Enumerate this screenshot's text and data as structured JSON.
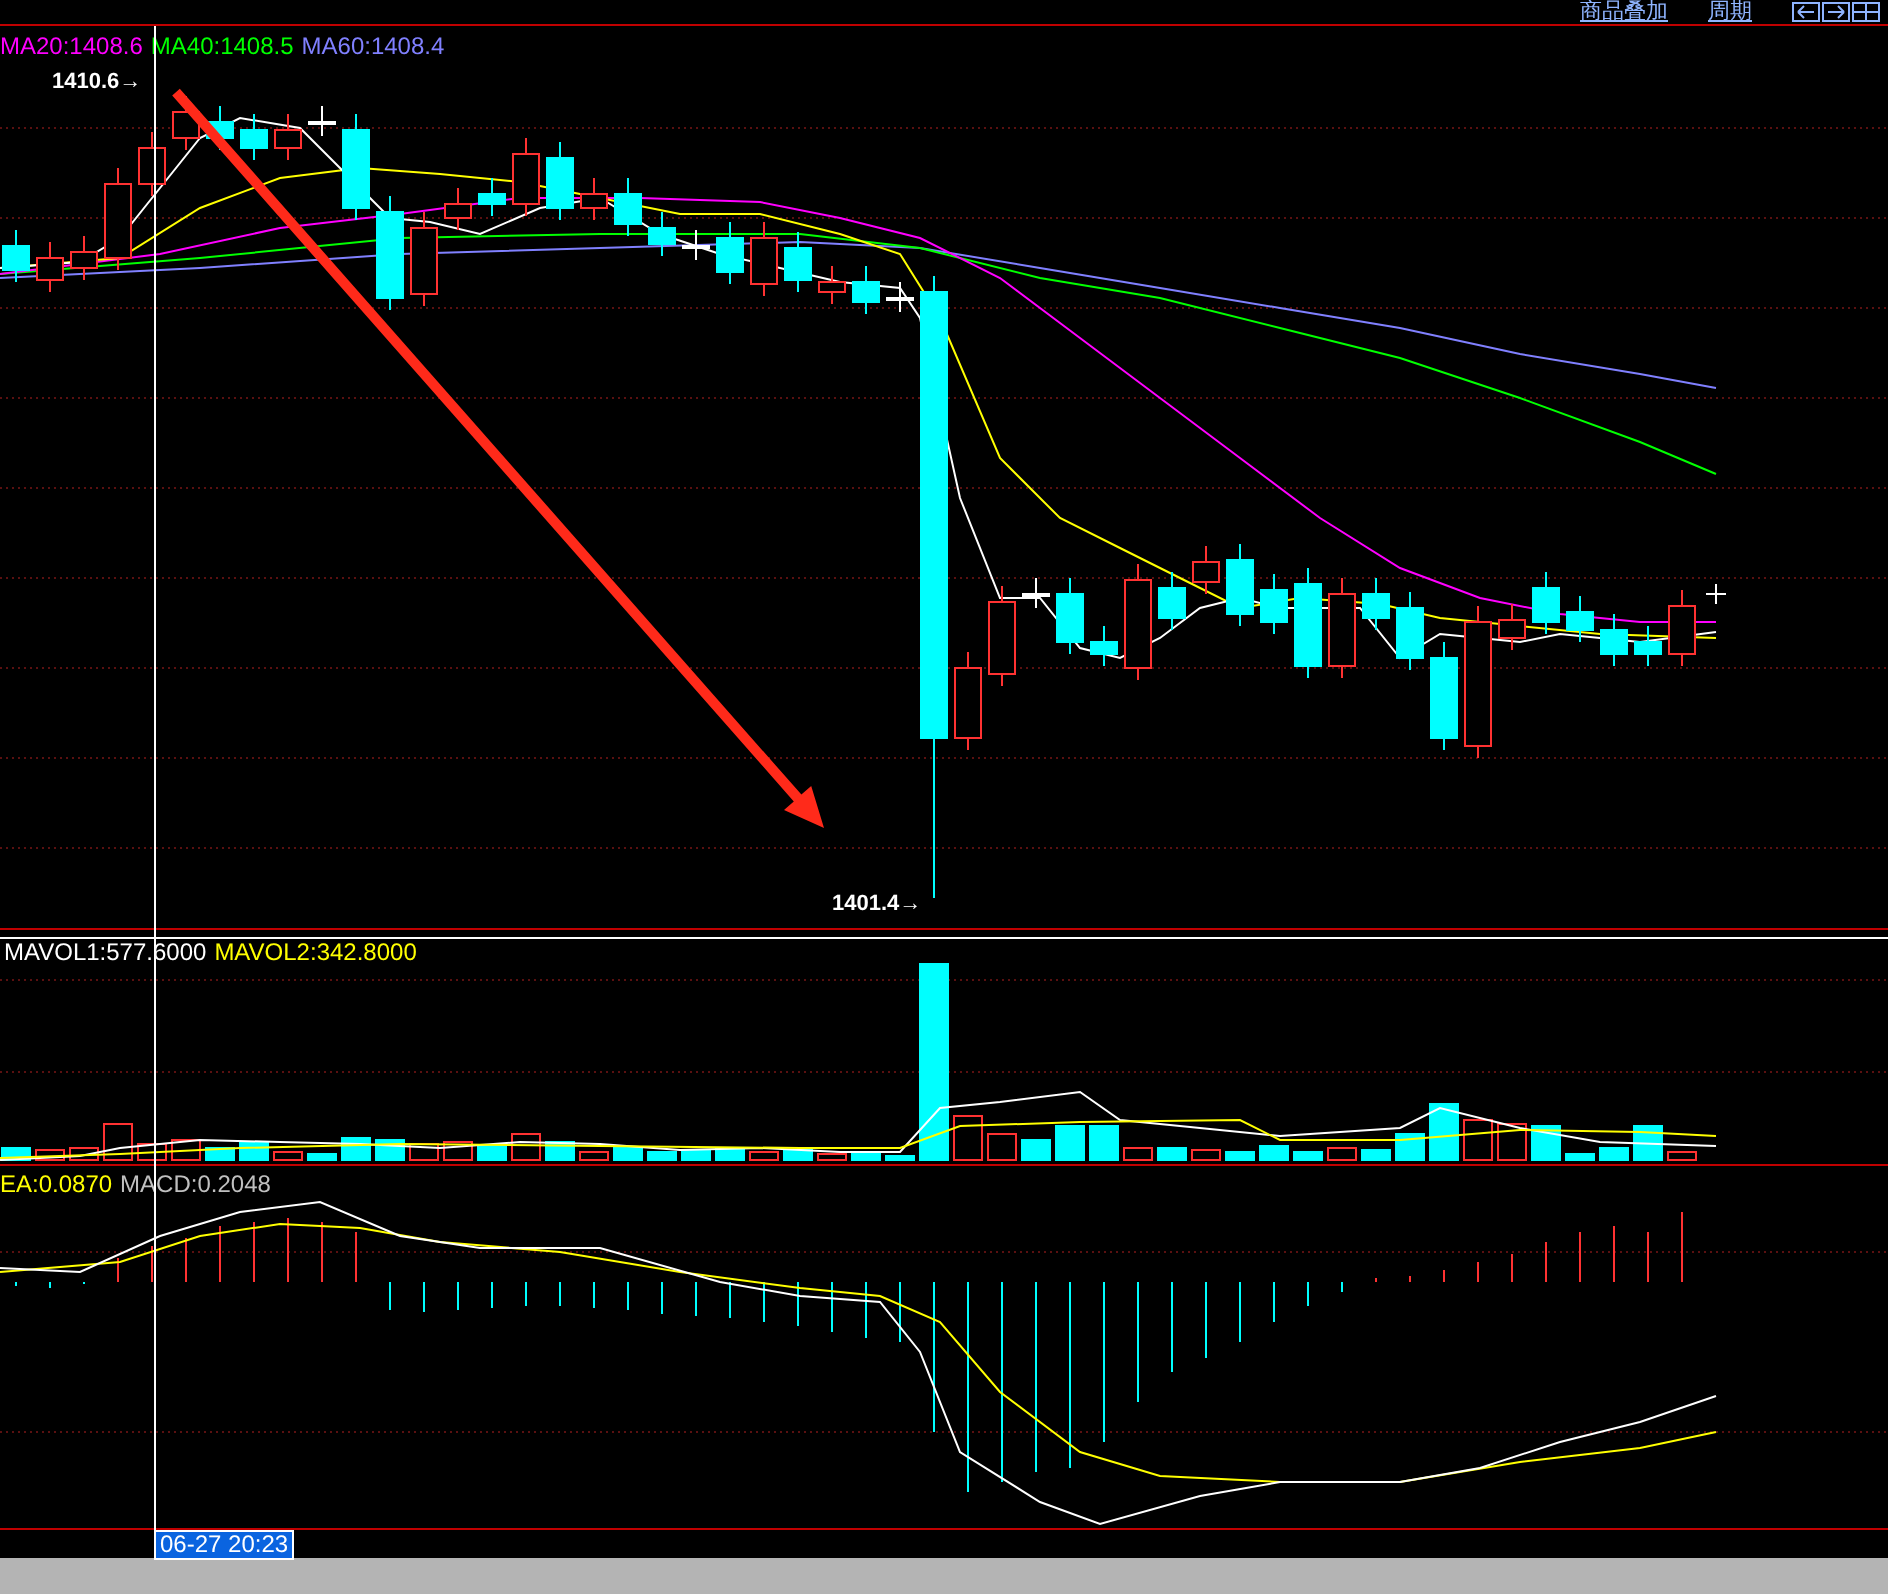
{
  "toolbar": {
    "links": [
      {
        "label": "商品叠加"
      },
      {
        "label": "周期"
      }
    ]
  },
  "ma_labels": [
    {
      "text": "MA20:1408.6",
      "color": "#ff00ff"
    },
    {
      "text": "MA40:1408.5",
      "color": "#00ff00"
    },
    {
      "text": "MA60:1408.4",
      "color": "#8080ff"
    }
  ],
  "high_label": "1410.6→",
  "low_label": "1401.4→",
  "volume_labels": [
    {
      "text": "MAVOL1:577.6000",
      "color": "#ffffff"
    },
    {
      "text": "MAVOL2:342.8000",
      "color": "#ffff00"
    }
  ],
  "macd_labels": [
    {
      "text": "EA:0.0870",
      "color": "#ffff00"
    },
    {
      "text": "MACD:0.2048",
      "color": "#c0c0c0"
    }
  ],
  "time_label": "06-27 20:23"
}
